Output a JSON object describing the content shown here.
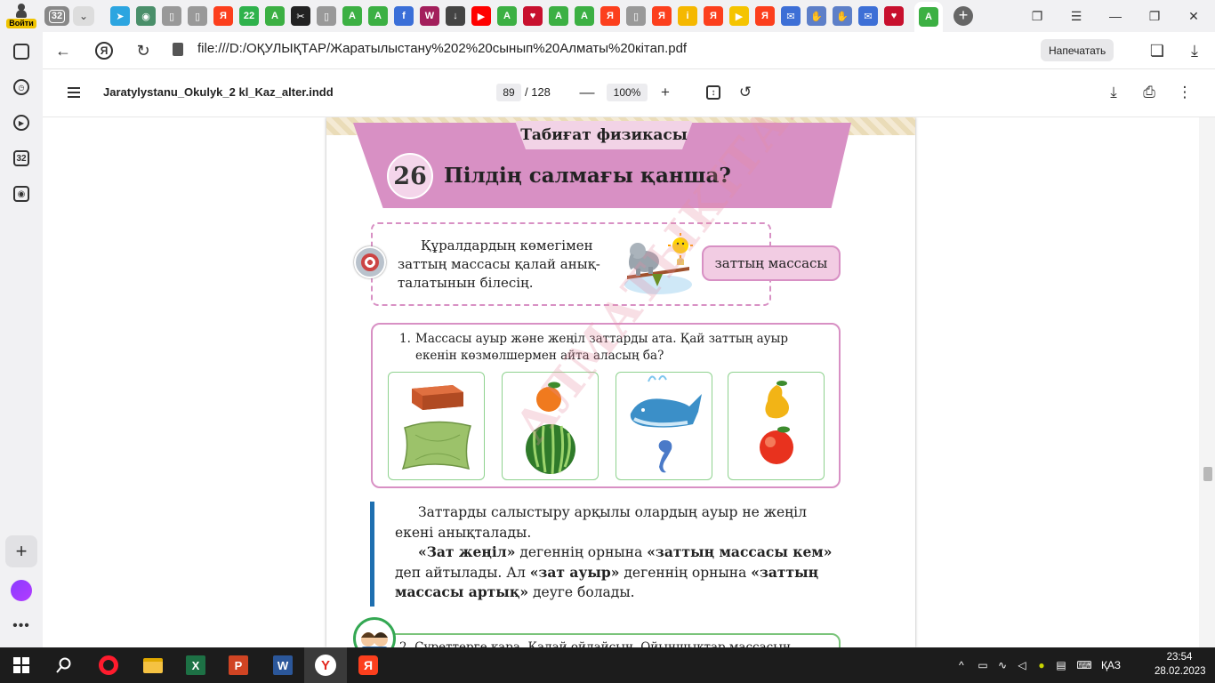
{
  "browser": {
    "login_label": "Войти",
    "tab_count": "32",
    "tab_favicons": [
      {
        "icon": "telegram-icon",
        "color": "#2ca5e0",
        "glyph": "➤"
      },
      {
        "icon": "globe-icon",
        "color": "#4a8f6a",
        "glyph": "◉"
      },
      {
        "icon": "document-icon",
        "color": "#999999",
        "glyph": "▯"
      },
      {
        "icon": "document-icon",
        "color": "#999999",
        "glyph": "▯"
      },
      {
        "icon": "yandex-icon",
        "color": "#fc3f1d",
        "glyph": "Я"
      },
      {
        "icon": "badge-22-icon",
        "color": "#2fb24c",
        "glyph": "22"
      },
      {
        "icon": "green-a-icon",
        "color": "#3cb043",
        "glyph": "A"
      },
      {
        "icon": "capcut-icon",
        "color": "#222222",
        "glyph": "✂"
      },
      {
        "icon": "document-icon",
        "color": "#999999",
        "glyph": "▯"
      },
      {
        "icon": "green-a-icon",
        "color": "#3cb043",
        "glyph": "A"
      },
      {
        "icon": "green-a-icon",
        "color": "#3cb043",
        "glyph": "A"
      },
      {
        "icon": "feather-icon",
        "color": "#3b6fd8",
        "glyph": "f"
      },
      {
        "icon": "wa-icon",
        "color": "#a31f5c",
        "glyph": "W"
      },
      {
        "icon": "download-icon",
        "color": "#444444",
        "glyph": "↓"
      },
      {
        "icon": "youtube-icon",
        "color": "#ff0000",
        "glyph": "▶"
      },
      {
        "icon": "green-a-icon",
        "color": "#3cb043",
        "glyph": "A"
      },
      {
        "icon": "shield-icon",
        "color": "#c8102e",
        "glyph": "♥"
      },
      {
        "icon": "green-a-icon",
        "color": "#3cb043",
        "glyph": "A"
      },
      {
        "icon": "green-a-icon",
        "color": "#3cb043",
        "glyph": "A"
      },
      {
        "icon": "yandex-icon",
        "color": "#fc3f1d",
        "glyph": "Я"
      },
      {
        "icon": "document-icon",
        "color": "#999999",
        "glyph": "▯"
      },
      {
        "icon": "yandex-icon",
        "color": "#fc3f1d",
        "glyph": "Я"
      },
      {
        "icon": "info-icon",
        "color": "#f5b800",
        "glyph": "i"
      },
      {
        "icon": "yandex-icon",
        "color": "#fc3f1d",
        "glyph": "Я"
      },
      {
        "icon": "play-icon",
        "color": "#f5c400",
        "glyph": "▶"
      },
      {
        "icon": "yandex-icon",
        "color": "#fc3f1d",
        "glyph": "Я"
      },
      {
        "icon": "mail-icon",
        "color": "#3d6fd6",
        "glyph": "✉"
      },
      {
        "icon": "hand-icon",
        "color": "#5d7fc8",
        "glyph": "✋"
      },
      {
        "icon": "hand-icon",
        "color": "#5d7fc8",
        "glyph": "✋"
      },
      {
        "icon": "mail-icon",
        "color": "#3d6fd6",
        "glyph": "✉"
      },
      {
        "icon": "shield-icon",
        "color": "#c8102e",
        "glyph": "♥"
      }
    ],
    "url": "file:///D:/ОҚУЛЫҚТАР/Жаратылыстану%202%20сынып%20Алматы%20кітап.pdf",
    "print_button": "Напечатать"
  },
  "pdf_toolbar": {
    "doc_title": "Jaratylystanu_Okulyk_2 kl_Kaz_alter.indd",
    "current_page": "89",
    "total_pages": "/ 128",
    "zoom": "100%"
  },
  "page": {
    "category": "Табиғат физикасы",
    "lesson_number": "26",
    "lesson_title": "Пілдің салмағы қанша?",
    "goal_lines": [
      "Құралдардың көмегімен",
      "заттың массасы қалай анық-",
      "талатынын білесің."
    ],
    "keyword": "заттың массасы",
    "task1_number": "1.",
    "task1_lines": [
      "Массасы ауыр және жеңіл заттарды ата. Қай заттың ауыр",
      "екенін көзмөлшермен айта аласың ба?"
    ],
    "cards": [
      {
        "top": "brick-image",
        "bottom": "pillow-image"
      },
      {
        "top": "apricot-image",
        "bottom": "watermelon-image"
      },
      {
        "top": "whale-image",
        "bottom": "seahorse-image"
      },
      {
        "top": "pear-image",
        "bottom": "apple-image"
      }
    ],
    "watermark": "АЛМАТЫКІТАП БАСПАСЫ",
    "info": {
      "p1": "Заттарды салыстыру арқылы олардың ауыр не жеңіл екені анықталады.",
      "p2_b1": "«Зат жеңіл»",
      "p2_t1": " дегеннің орнына ",
      "p2_b2": "«заттың массасы кем»",
      "p2_t2": " деп айтылады. Ал ",
      "p2_b3": "«зат ауыр»",
      "p2_t3": " дегеннің орнына ",
      "p2_b4": "«заттың массасы артық»",
      "p2_t4": " деуге болады."
    },
    "task2_partial": "2. Суреттерге қара. Қалай ойлайсың, Ойыншықтар массасын"
  },
  "taskbar": {
    "language": "ҚАЗ",
    "time": "23:54",
    "date": "28.02.2023"
  }
}
